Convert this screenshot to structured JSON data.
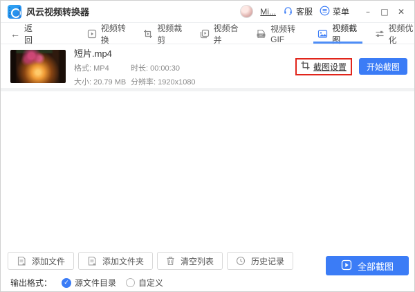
{
  "window": {
    "title": "风云视频转换器",
    "user": "Mi...",
    "service_label": "客服",
    "menu_label": "菜单",
    "minimize": "–",
    "maximize": "□",
    "close": "✕"
  },
  "nav": {
    "back_label": "返回",
    "back_arrow": "←",
    "tabs": [
      {
        "label": "视频转换",
        "active": false
      },
      {
        "label": "视频裁剪",
        "active": false
      },
      {
        "label": "视频合并",
        "active": false
      },
      {
        "label": "视频转GIF",
        "active": false
      },
      {
        "label": "视频截图",
        "active": true
      },
      {
        "label": "视频优化",
        "active": false
      }
    ]
  },
  "file": {
    "name": "短片.mp4",
    "format": "格式: MP4",
    "duration": "时长: 00:00:30",
    "size": "大小: 20.79 MB",
    "resolution": "分辨率: 1920x1080",
    "settings_label": "截图设置",
    "start_label": "开始截图"
  },
  "toolbar": {
    "add_file": "添加文件",
    "add_folder": "添加文件夹",
    "clear_list": "清空列表",
    "history": "历史记录",
    "screenshot_all": "全部截图"
  },
  "output": {
    "label": "输出格式：",
    "option_source": "源文件目录",
    "option_custom": "自定义",
    "check_mark": "✓"
  },
  "colors": {
    "accent": "#3b7cf6",
    "annotation_red": "#e1251b",
    "tab_underline": "#4d8df7"
  }
}
